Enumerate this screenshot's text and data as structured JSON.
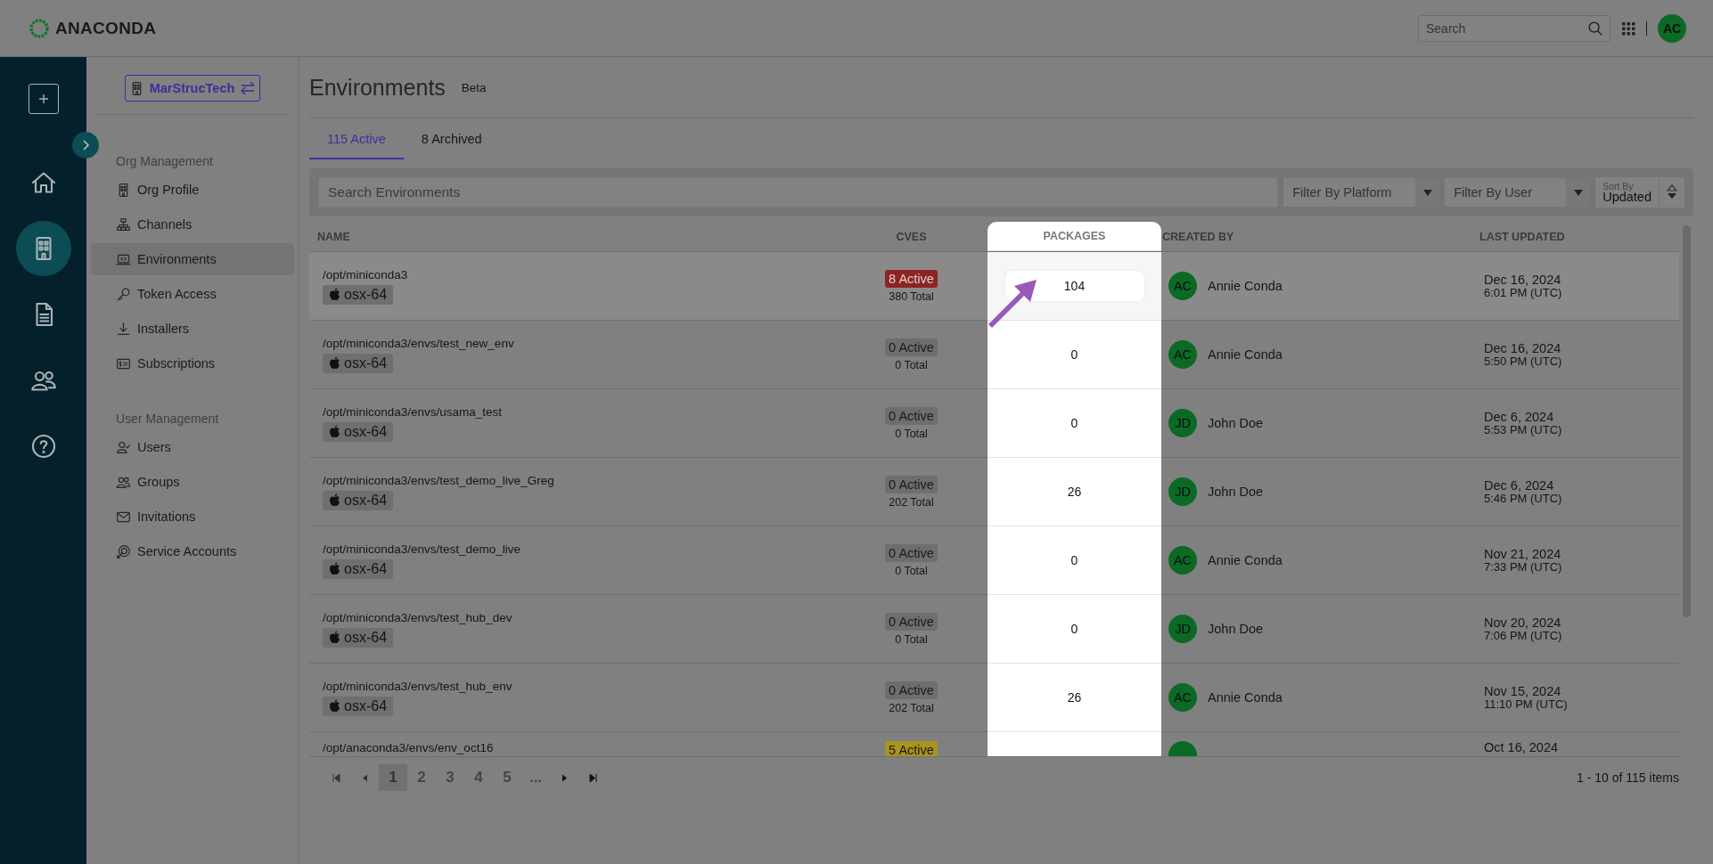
{
  "brand": {
    "name": "ANACONDA"
  },
  "top_bar": {
    "search": {
      "placeholder": "Search"
    },
    "user_initials": "AC"
  },
  "rail": {
    "items": [
      {
        "kind": "home",
        "selected": false
      },
      {
        "kind": "organization",
        "selected": true
      },
      {
        "kind": "document",
        "selected": false
      },
      {
        "kind": "people",
        "selected": false
      },
      {
        "kind": "help",
        "selected": false
      }
    ]
  },
  "org_switcher": {
    "label": "MarStrucTech"
  },
  "sidebar": {
    "sections": [
      {
        "heading": "Org Management",
        "items": [
          {
            "label": "Org Profile",
            "kind": "building",
            "selected": false
          },
          {
            "label": "Channels",
            "kind": "network",
            "selected": false
          },
          {
            "label": "Environments",
            "kind": "laptop",
            "selected": true
          },
          {
            "label": "Token Access",
            "kind": "key",
            "selected": false
          },
          {
            "label": "Installers",
            "kind": "download",
            "selected": false
          },
          {
            "label": "Subscriptions",
            "kind": "billing",
            "selected": false
          }
        ]
      },
      {
        "heading": "User Management",
        "items": [
          {
            "label": "Users",
            "kind": "user-check",
            "selected": false
          },
          {
            "label": "Groups",
            "kind": "group",
            "selected": false
          },
          {
            "label": "Invitations",
            "kind": "mail",
            "selected": false
          },
          {
            "label": "Service Accounts",
            "kind": "service",
            "selected": false
          }
        ]
      }
    ]
  },
  "page": {
    "title": "Environments",
    "badge": "Beta"
  },
  "tabs": [
    {
      "label": "115 Active",
      "selected": true
    },
    {
      "label": "8 Archived",
      "selected": false
    }
  ],
  "filters": {
    "search": {
      "placeholder": "Search Environments"
    },
    "platform": {
      "placeholder": "Filter By Platform"
    },
    "user": {
      "placeholder": "Filter By User"
    },
    "sort": {
      "label": "Sort By",
      "value": "Updated"
    }
  },
  "table": {
    "columns": [
      "NAME",
      "CVES",
      "PACKAGES",
      "CREATED BY",
      "LAST UPDATED"
    ],
    "rows": [
      {
        "name": "/opt/miniconda3",
        "platform": "osx-64",
        "cves_active": "8 Active",
        "cves_total": "380 Total",
        "color": "#8c2424",
        "packages": "104",
        "creator_initials": "AC",
        "creator": "Annie Conda",
        "date": "Dec 16, 2024",
        "time": "6:01 PM (UTC)",
        "selected": true
      },
      {
        "name": "/opt/miniconda3/envs/test_new_env",
        "platform": "osx-64",
        "cves_active": "0 Active",
        "cves_total": "0 Total",
        "color": "#6e6e6e",
        "packages": "0",
        "creator_initials": "AC",
        "creator": "Annie Conda",
        "date": "Dec 16, 2024",
        "time": "5:50 PM (UTC)",
        "selected": false
      },
      {
        "name": "/opt/miniconda3/envs/usama_test",
        "platform": "osx-64",
        "cves_active": "0 Active",
        "cves_total": "0 Total",
        "color": "#6e6e6e",
        "packages": "0",
        "creator_initials": "JD",
        "creator": "John Doe",
        "date": "Dec 6, 2024",
        "time": "5:53 PM (UTC)",
        "selected": false
      },
      {
        "name": "/opt/miniconda3/envs/test_demo_live_Greg",
        "platform": "osx-64",
        "cves_active": "0 Active",
        "cves_total": "202 Total",
        "color": "#6e6e6e",
        "packages": "26",
        "creator_initials": "JD",
        "creator": "John Doe",
        "date": "Dec 6, 2024",
        "time": "5:46 PM (UTC)",
        "selected": false
      },
      {
        "name": "/opt/miniconda3/envs/test_demo_live",
        "platform": "osx-64",
        "cves_active": "0 Active",
        "cves_total": "0 Total",
        "color": "#6e6e6e",
        "packages": "0",
        "creator_initials": "AC",
        "creator": "Annie Conda",
        "date": "Nov 21, 2024",
        "time": "7:33 PM (UTC)",
        "selected": false
      },
      {
        "name": "/opt/miniconda3/envs/test_hub_dev",
        "platform": "osx-64",
        "cves_active": "0 Active",
        "cves_total": "0 Total",
        "color": "#6e6e6e",
        "packages": "0",
        "creator_initials": "JD",
        "creator": "John Doe",
        "date": "Nov 20, 2024",
        "time": "7:06 PM (UTC)",
        "selected": false
      },
      {
        "name": "/opt/miniconda3/envs/test_hub_env",
        "platform": "osx-64",
        "cves_active": "0 Active",
        "cves_total": "202 Total",
        "color": "#6e6e6e",
        "packages": "26",
        "creator_initials": "AC",
        "creator": "Annie Conda",
        "date": "Nov 15, 2024",
        "time": "11:10 PM (UTC)",
        "selected": false
      },
      {
        "name": "/opt/anaconda3/envs/env_oct16",
        "cves_active": "5 Active",
        "color": "#a8941e",
        "date": "Oct 16, 2024"
      }
    ]
  },
  "pagination": {
    "pages": [
      {
        "label": "1",
        "selected": true
      },
      {
        "label": "2",
        "selected": false
      },
      {
        "label": "3",
        "selected": false
      },
      {
        "label": "4",
        "selected": false
      },
      {
        "label": "5",
        "selected": false
      }
    ],
    "ellipsis": "...",
    "summary": "1 - 10 of 115 items"
  }
}
